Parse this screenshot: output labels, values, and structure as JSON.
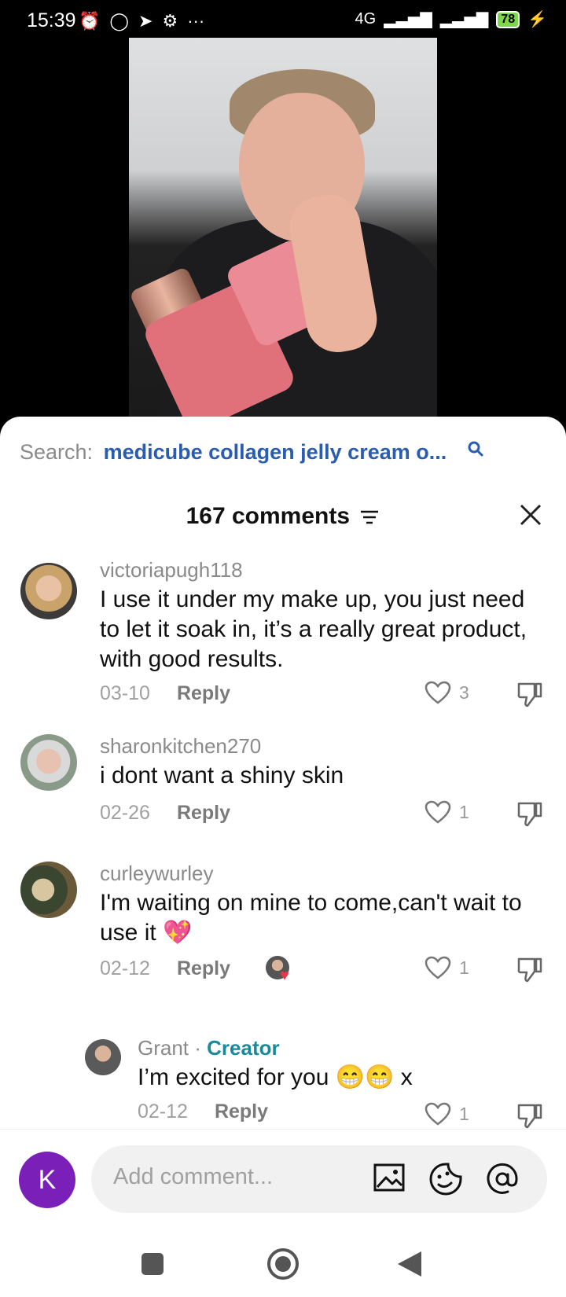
{
  "status": {
    "time": "15:39",
    "network": "4G",
    "battery": "78"
  },
  "search": {
    "label": "Search:",
    "query": "medicube collagen jelly cream o..."
  },
  "header": {
    "count_label": "167 comments"
  },
  "comments": [
    {
      "username": "victoriapugh118",
      "text": "I use it under my make up, you just need to let it soak in, it’s a really great product, with good results.",
      "date": "03-10",
      "reply": "Reply",
      "likes": "3"
    },
    {
      "username": "sharonkitchen270",
      "text": "i dont want a shiny skin",
      "date": "02-26",
      "reply": "Reply",
      "likes": "1"
    },
    {
      "username": "curleywurley",
      "text": "I'm waiting on mine to come,can't wait to use it 💖",
      "date": "02-12",
      "reply": "Reply",
      "likes": "1"
    }
  ],
  "reply_comment": {
    "username": "Grant",
    "separator": " · ",
    "badge": "Creator",
    "text": "I’m excited for you 😁😁 x",
    "date": "02-12",
    "reply": "Reply",
    "likes": "1"
  },
  "composer": {
    "avatar_letter": "K",
    "placeholder": "Add comment..."
  },
  "colors": {
    "accent_blue": "#2a5db0",
    "creator_teal": "#1a8a9a",
    "avatar_purple": "#7a1fb8"
  }
}
